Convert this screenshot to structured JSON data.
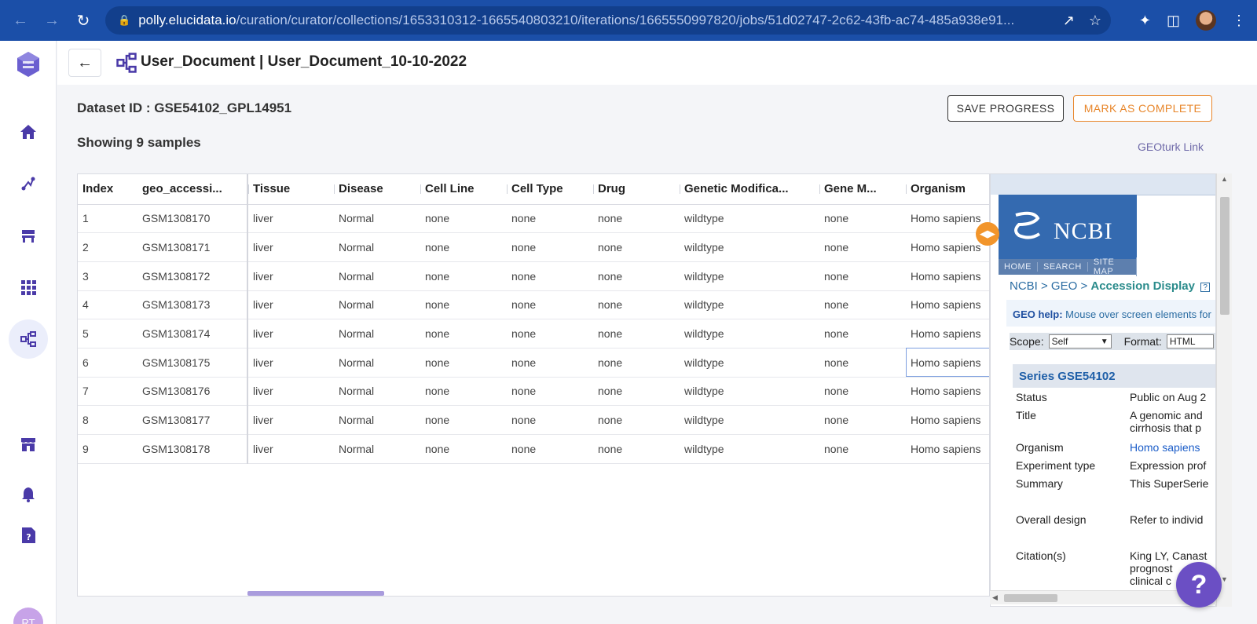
{
  "browser": {
    "url_host": "polly.elucidata.io",
    "url_path": "/curation/curator/collections/1653310312-1665540803210/iterations/1665550997820/jobs/51d02747-2c62-43fb-ac74-485a938e91..."
  },
  "sidebar": {
    "items": [
      {
        "icon": "home-icon"
      },
      {
        "icon": "pipeline-icon"
      },
      {
        "icon": "workspace-icon"
      },
      {
        "icon": "apps-grid-icon"
      },
      {
        "icon": "curation-icon",
        "active": true
      },
      {
        "icon": "store-icon"
      },
      {
        "icon": "bell-icon"
      },
      {
        "icon": "help-doc-icon"
      }
    ],
    "avatar_initials": "RT"
  },
  "header": {
    "title": "User_Document | User_Document_10-10-2022"
  },
  "meta": {
    "dataset_id": "Dataset ID : GSE54102_GPL14951",
    "samples": "Showing 9 samples",
    "save_label": "SAVE PROGRESS",
    "complete_label": "MARK AS COMPLETE",
    "geoturk_label": "GEOturk Link"
  },
  "table": {
    "columns": [
      "Index",
      "geo_accessi...",
      "Tissue",
      "Disease",
      "Cell Line",
      "Cell Type",
      "Drug",
      "Genetic Modifica...",
      "Gene M...",
      "Organism"
    ],
    "rows": [
      [
        "1",
        "GSM1308170",
        "liver",
        "Normal",
        "none",
        "none",
        "none",
        "wildtype",
        "none",
        "Homo sapiens"
      ],
      [
        "2",
        "GSM1308171",
        "liver",
        "Normal",
        "none",
        "none",
        "none",
        "wildtype",
        "none",
        "Homo sapiens"
      ],
      [
        "3",
        "GSM1308172",
        "liver",
        "Normal",
        "none",
        "none",
        "none",
        "wildtype",
        "none",
        "Homo sapiens"
      ],
      [
        "4",
        "GSM1308173",
        "liver",
        "Normal",
        "none",
        "none",
        "none",
        "wildtype",
        "none",
        "Homo sapiens"
      ],
      [
        "5",
        "GSM1308174",
        "liver",
        "Normal",
        "none",
        "none",
        "none",
        "wildtype",
        "none",
        "Homo sapiens"
      ],
      [
        "6",
        "GSM1308175",
        "liver",
        "Normal",
        "none",
        "none",
        "none",
        "wildtype",
        "none",
        "Homo sapiens"
      ],
      [
        "7",
        "GSM1308176",
        "liver",
        "Normal",
        "none",
        "none",
        "none",
        "wildtype",
        "none",
        "Homo sapiens"
      ],
      [
        "8",
        "GSM1308177",
        "liver",
        "Normal",
        "none",
        "none",
        "none",
        "wildtype",
        "none",
        "Homo sapiens"
      ],
      [
        "9",
        "GSM1308178",
        "liver",
        "Normal",
        "none",
        "none",
        "none",
        "wildtype",
        "none",
        "Homo sapiens"
      ]
    ]
  },
  "geo": {
    "logo_text": "NCBI",
    "nav": [
      "HOME",
      "SEARCH",
      "SITE MAP"
    ],
    "breadcrumb_a": "NCBI > GEO > ",
    "breadcrumb_b": "Accession Display",
    "help_bold": "GEO help:",
    "help_text": " Mouse over screen elements for",
    "scope_label": "Scope:",
    "scope_value": "Self",
    "format_label": "Format:",
    "format_value": "HTML",
    "series_title": "Series GSE54102",
    "rows": [
      {
        "k": "Status",
        "v": "Public on Aug 2"
      },
      {
        "k": "Title",
        "v": "A genomic and"
      },
      {
        "k": "",
        "v": "cirrhosis that p"
      },
      {
        "k": "Organism",
        "v": "Homo sapiens"
      },
      {
        "k": "Experiment type",
        "v": "Expression prof"
      },
      {
        "k": "Summary",
        "v": "This SuperSerie"
      },
      {
        "k": "Overall design",
        "v": "Refer to individ"
      },
      {
        "k": "Citation(s)",
        "v": "King LY, Canast"
      },
      {
        "k": "",
        "v": "prognost"
      },
      {
        "k": "",
        "v": "clinical c"
      }
    ]
  },
  "colors": {
    "brand": "#4a3aa8",
    "accent_orange": "#e8862a",
    "browser_bar": "#1b4fa8"
  }
}
